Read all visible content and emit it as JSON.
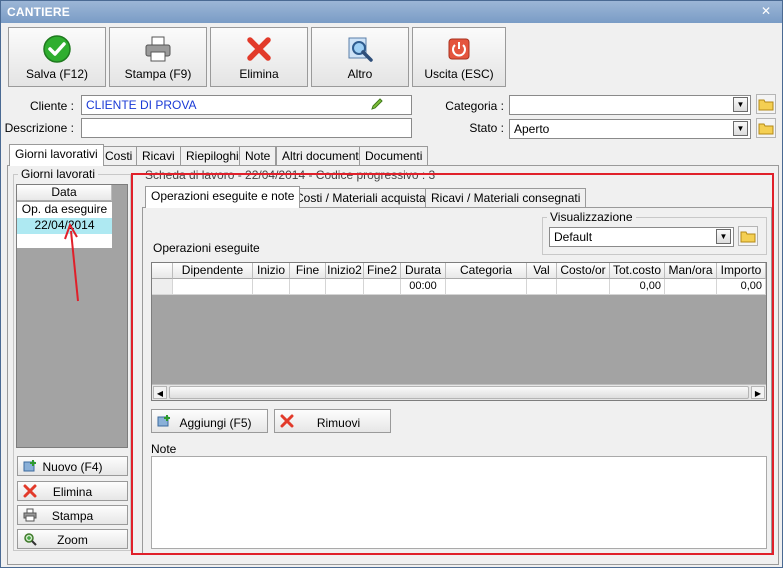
{
  "window": {
    "title": "CANTIERE",
    "close_glyph": "✕"
  },
  "toolbar": {
    "save": "Salva (F12)",
    "print": "Stampa (F9)",
    "delete": "Elimina",
    "other": "Altro",
    "exit": "Uscita (ESC)"
  },
  "form": {
    "cliente_label": "Cliente :",
    "cliente_value": "CLIENTE DI PROVA",
    "descrizione_label": "Descrizione :",
    "descrizione_value": "",
    "categoria_label": "Categoria :",
    "categoria_value": "",
    "stato_label": "Stato :",
    "stato_value": "Aperto"
  },
  "main_tabs": [
    {
      "label": "Giorni lavorativi"
    },
    {
      "label": "Costi"
    },
    {
      "label": "Ricavi"
    },
    {
      "label": "Riepiloghi"
    },
    {
      "label": "Note"
    },
    {
      "label": "Altri documenti"
    },
    {
      "label": "Documenti"
    }
  ],
  "days_group": {
    "title": "Giorni lavorati",
    "column": "Data",
    "rows": [
      "Op. da eseguire",
      "22/04/2014"
    ]
  },
  "days_buttons": {
    "new": "Nuovo (F4)",
    "delete": "Elimina",
    "print": "Stampa",
    "zoom": "Zoom"
  },
  "scheda": {
    "title": "Scheda di lavoro - 22/04/2014 - Codice progressivo : 3"
  },
  "sub_tabs": [
    {
      "label": "Operazioni eseguite e note"
    },
    {
      "label": "Costi / Materiali acquistati"
    },
    {
      "label": "Ricavi / Materiali consegnati"
    }
  ],
  "view": {
    "title": "Visualizzazione",
    "value": "Default"
  },
  "operations": {
    "title": "Operazioni eseguite",
    "columns": [
      "Dipendente",
      "Inizio",
      "Fine",
      "Inizio2",
      "Fine2",
      "Durata",
      "Categoria",
      "Val",
      "Costo/or",
      "Tot.costo",
      "Man/ora",
      "Importo"
    ],
    "row": [
      "",
      "",
      "",
      "",
      "",
      "00:00",
      "",
      "",
      "",
      "0,00",
      "",
      "0,00"
    ]
  },
  "ops_buttons": {
    "add": "Aggiungi (F5)",
    "remove": "Rimuovi"
  },
  "note": {
    "label": "Note",
    "value": ""
  },
  "colors": {
    "highlight_frame": "#e0202a",
    "selected_row": "#aee9f2",
    "arrow": "#e0202a"
  }
}
